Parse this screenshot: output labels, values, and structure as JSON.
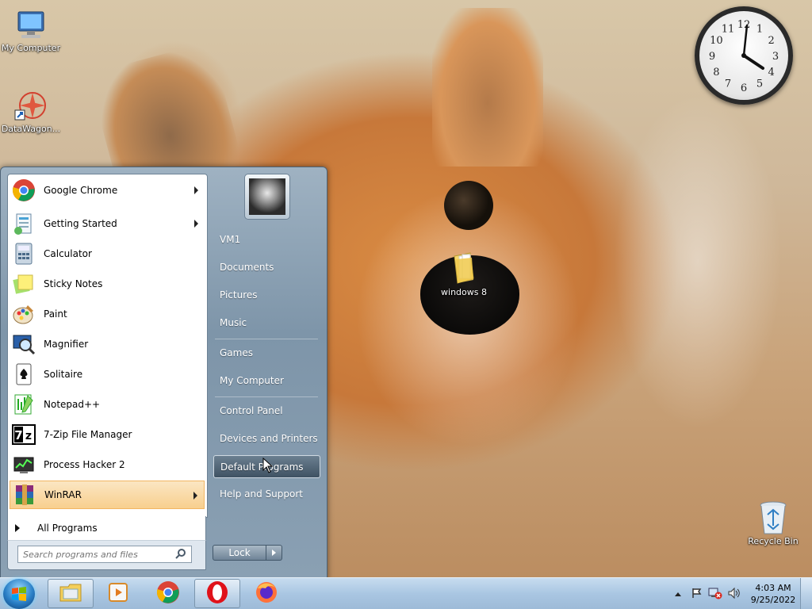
{
  "desktop": {
    "icons": [
      {
        "label": "My Computer"
      },
      {
        "label": "DataWagon..."
      },
      {
        "label": "windows 8"
      },
      {
        "label": "Recycle Bin"
      }
    ],
    "clock_gadget": {
      "numerals": [
        "12",
        "1",
        "2",
        "3",
        "4",
        "5",
        "6",
        "7",
        "8",
        "9",
        "10",
        "11"
      ],
      "time": "4:03"
    }
  },
  "start_menu": {
    "programs": [
      {
        "label": "Google Chrome",
        "icon": "chrome-icon",
        "has_submenu": true
      },
      {
        "label": "Getting Started",
        "icon": "getting-started-icon",
        "has_submenu": true
      },
      {
        "label": "Calculator",
        "icon": "calculator-icon",
        "has_submenu": false
      },
      {
        "label": "Sticky Notes",
        "icon": "sticky-notes-icon",
        "has_submenu": false
      },
      {
        "label": "Paint",
        "icon": "paint-icon",
        "has_submenu": false
      },
      {
        "label": "Magnifier",
        "icon": "magnifier-icon",
        "has_submenu": false
      },
      {
        "label": "Solitaire",
        "icon": "solitaire-icon",
        "has_submenu": false
      },
      {
        "label": "Notepad++",
        "icon": "notepad-plus-plus-icon",
        "has_submenu": false
      },
      {
        "label": "7-Zip File Manager",
        "icon": "seven-zip-icon",
        "has_submenu": false
      },
      {
        "label": "Process Hacker 2",
        "icon": "process-hacker-icon",
        "has_submenu": false
      },
      {
        "label": "WinRAR",
        "icon": "winrar-icon",
        "has_submenu": true
      }
    ],
    "all_programs": "All Programs",
    "search_placeholder": "Search programs and files",
    "right_links": [
      {
        "label": "VM1"
      },
      {
        "label": "Documents"
      },
      {
        "label": "Pictures"
      },
      {
        "label": "Music"
      },
      {
        "label": "Games"
      },
      {
        "label": "My Computer"
      },
      {
        "label": "Control Panel"
      },
      {
        "label": "Devices and Printers"
      },
      {
        "label": "Default Programs"
      },
      {
        "label": "Help and Support"
      }
    ],
    "lock_label": "Lock"
  },
  "taskbar": {
    "pinned": [
      "windows-explorer-icon",
      "media-player-icon",
      "chrome-icon",
      "opera-icon",
      "firefox-icon"
    ],
    "time": "4:03 AM",
    "date": "9/25/2022"
  },
  "colors": {
    "highlight": "#f8cf8e",
    "taskbar": "#a9c6e2",
    "start_pane": "#8aa0b3"
  }
}
